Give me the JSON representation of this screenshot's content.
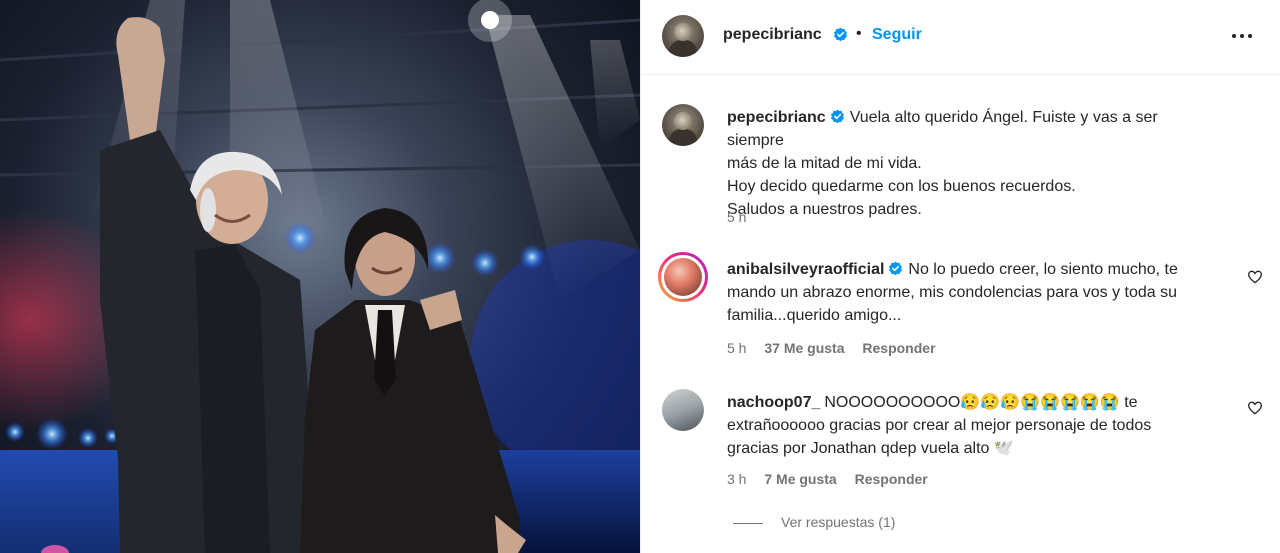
{
  "post": {
    "username": "pepecibrianc",
    "follow_label": "Seguir"
  },
  "caption": {
    "username": "pepecibrianc",
    "lines": [
      "Vuela alto querido Ángel. Fuiste y vas a ser siempre",
      "más de la mitad de mi vida.",
      "Hoy decido quedarme con los buenos recuerdos.",
      "Saludos a nuestros padres."
    ],
    "time": "5 h"
  },
  "comments": [
    {
      "username": "anibalsilveyraofficial",
      "lines": [
        "No lo puedo creer, lo siento mucho, te",
        "mando un abrazo enorme, mis condolencias para vos y toda su",
        "familia...querido amigo..."
      ],
      "time": "5 h",
      "likes": "37 Me gusta",
      "reply": "Responder"
    },
    {
      "username": "nachoop07_",
      "lines": [
        "NOOOOOOOOOO😥😥😥😭😭😭😭😭 te",
        "extrañoooooo gracias por crear al mejor personaje de todos",
        "gracias por Jonathan qdep vuela alto 🕊️"
      ],
      "time": "3 h",
      "likes": "7 Me gusta",
      "reply": "Responder"
    }
  ],
  "view_replies": "Ver respuestas (1)",
  "colors": {
    "accent": "#0095f6",
    "text": "#262626",
    "muted": "#737373",
    "verified": "#0095f6"
  },
  "icons": [
    "verified-badge-icon",
    "more-options-icon",
    "heart-icon"
  ]
}
